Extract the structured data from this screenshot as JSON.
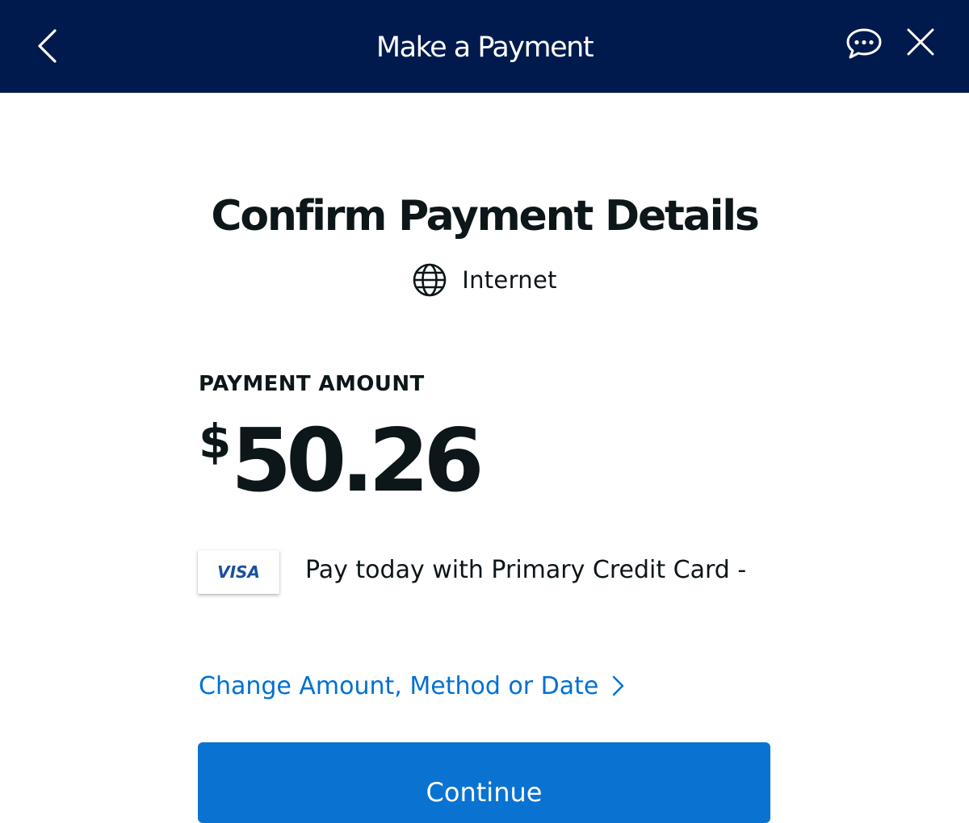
{
  "header": {
    "title": "Make a Payment",
    "back_icon": "chevron-left-icon",
    "chat_icon": "chat-bubble-icon",
    "close_icon": "close-icon",
    "background_color": "#001a4d"
  },
  "main": {
    "heading": "Confirm Payment Details",
    "service": {
      "icon": "globe-icon",
      "label": "Internet"
    },
    "amount": {
      "label": "PAYMENT AMOUNT",
      "currency": "$",
      "value": "50.26"
    },
    "payment_method": {
      "card_brand": "VISA",
      "description": "Pay today with Primary Credit Card -"
    },
    "change_link": {
      "label": "Change Amount, Method or Date",
      "icon": "chevron-right-icon"
    },
    "continue_button": {
      "label": "Continue"
    }
  },
  "colors": {
    "accent": "#0070d2",
    "button": "#0a73d1",
    "text": "#0d1619"
  }
}
